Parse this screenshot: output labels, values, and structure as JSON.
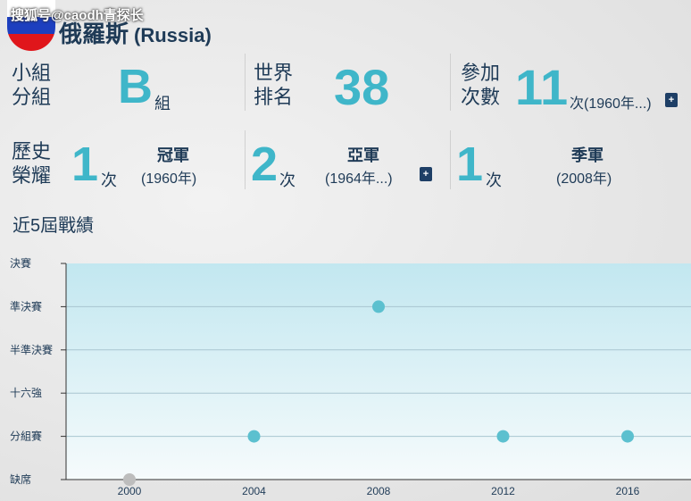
{
  "watermark": "搜狐号@caodh青探长",
  "team": {
    "name_zh": "俄羅斯",
    "name_en": "(Russia)"
  },
  "stats": {
    "group": {
      "label_line1": "小組",
      "label_line2": "分組",
      "value": "B",
      "unit": "組"
    },
    "ranking": {
      "label_line1": "世界",
      "label_line2": "排名",
      "value": "38"
    },
    "appearances": {
      "label_line1": "參加",
      "label_line2": "次數",
      "value": "11",
      "unit": "次(1960年...)",
      "more_label": "+"
    }
  },
  "honors": {
    "label_line1": "歷史",
    "label_line2": "榮耀",
    "champion": {
      "count": "1",
      "unit": "次",
      "title": "冠軍",
      "years": "(1960年)"
    },
    "runner_up": {
      "count": "2",
      "unit": "次",
      "title": "亞軍",
      "years": "(1964年...)",
      "more_label": "+"
    },
    "third": {
      "count": "1",
      "unit": "次",
      "title": "季軍",
      "years": "(2008年)"
    }
  },
  "recent": {
    "title": "近5屆戰績"
  },
  "colors": {
    "accent": "#3fb6c9",
    "navy": "#1f3b57",
    "point": "#5cc0cf",
    "absent_point": "#bdbdbd",
    "plot_top": "#c2e7f0",
    "plot_bottom": "#f6fbfc"
  },
  "chart_data": {
    "type": "scatter",
    "x_categories": [
      "2000",
      "2004",
      "2008",
      "2012",
      "2016"
    ],
    "y_categories": [
      "缺席",
      "分組賽",
      "十六強",
      "半準決賽",
      "準決賽",
      "決賽"
    ],
    "points": [
      {
        "x": "2000",
        "y": "缺席"
      },
      {
        "x": "2004",
        "y": "分組賽"
      },
      {
        "x": "2008",
        "y": "準決賽"
      },
      {
        "x": "2012",
        "y": "分組賽"
      },
      {
        "x": "2016",
        "y": "分組賽"
      }
    ],
    "grid": true,
    "legend": "none"
  }
}
